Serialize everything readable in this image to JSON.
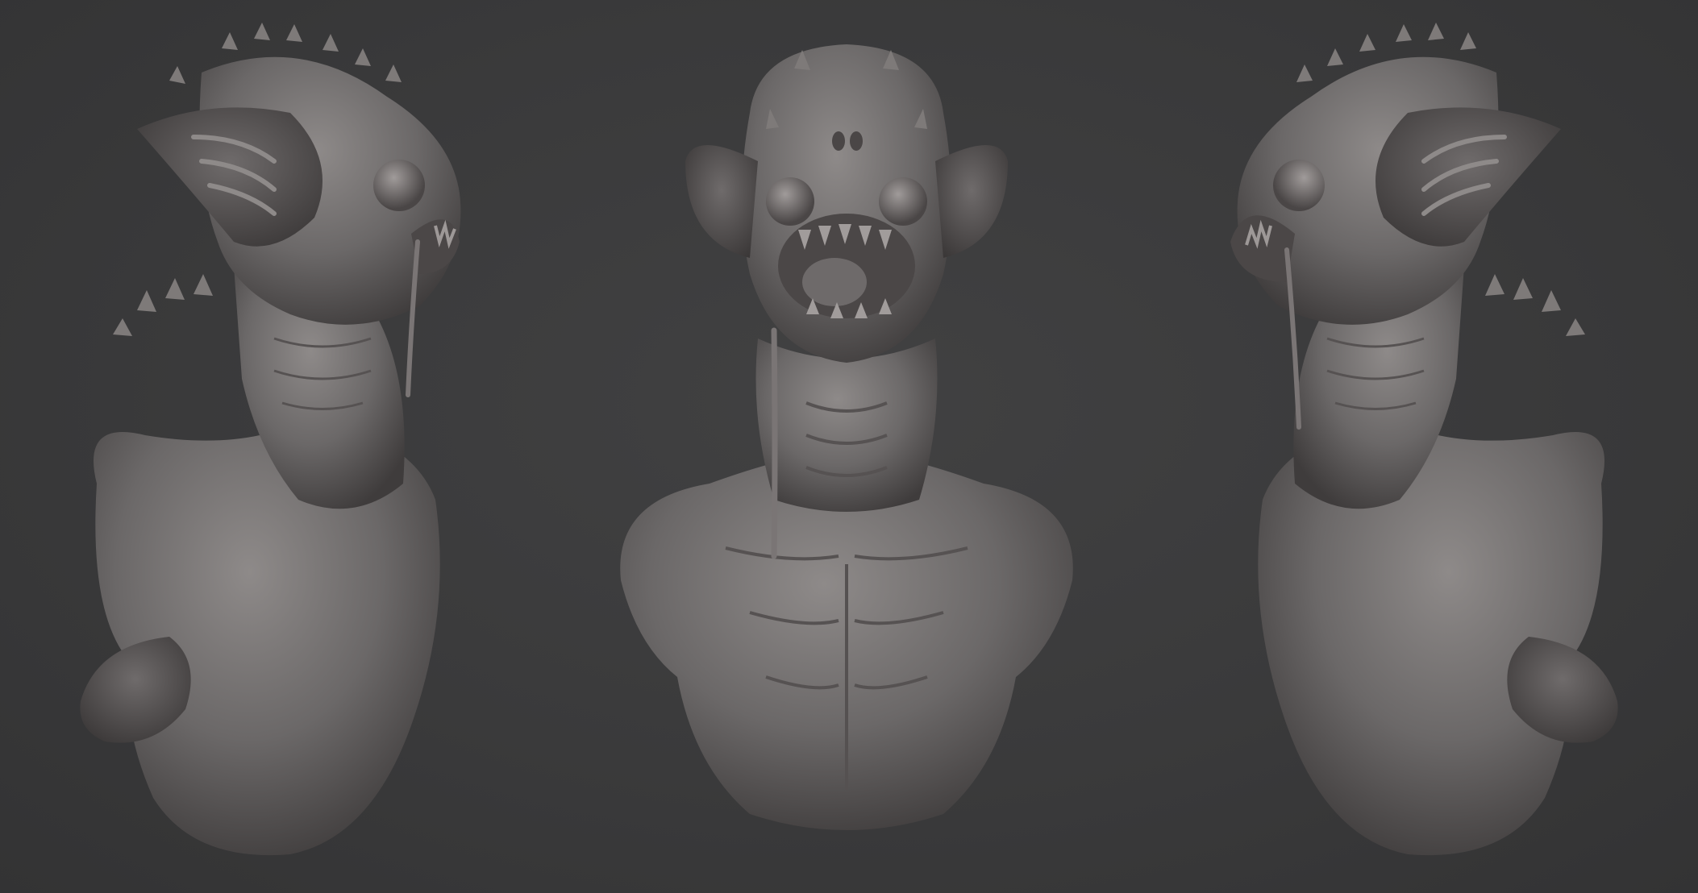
{
  "scene": {
    "background_color": "#3a3a3b",
    "material_color": "#6b6868",
    "material_highlight": "#8e8a89",
    "material_shadow": "#3f3c3c",
    "views": [
      {
        "id": "side-left",
        "facing": "right"
      },
      {
        "id": "front",
        "facing": "viewer"
      },
      {
        "id": "side-right",
        "facing": "left"
      }
    ]
  }
}
